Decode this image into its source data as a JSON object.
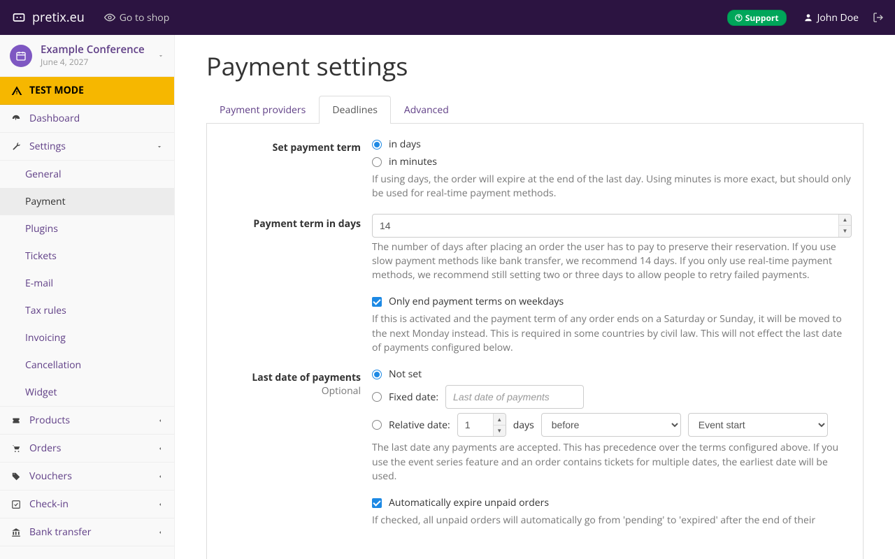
{
  "navbar": {
    "brand": "pretix.eu",
    "go_to_shop": "Go to shop",
    "support": "Support",
    "user": "John Doe"
  },
  "event": {
    "name": "Example Conference",
    "date": "June 4, 2027"
  },
  "test_mode": "TEST MODE",
  "sidebar": {
    "dashboard": "Dashboard",
    "settings": "Settings",
    "settings_sub": {
      "general": "General",
      "payment": "Payment",
      "plugins": "Plugins",
      "tickets": "Tickets",
      "email": "E-mail",
      "tax_rules": "Tax rules",
      "invoicing": "Invoicing",
      "cancellation": "Cancellation",
      "widget": "Widget"
    },
    "products": "Products",
    "orders": "Orders",
    "vouchers": "Vouchers",
    "checkin": "Check-in",
    "bank_transfer": "Bank transfer"
  },
  "page": {
    "title": "Payment settings",
    "tabs": {
      "providers": "Payment providers",
      "deadlines": "Deadlines",
      "advanced": "Advanced"
    }
  },
  "form": {
    "set_term": {
      "label": "Set payment term",
      "opt_days": "in days",
      "opt_minutes": "in minutes",
      "help": "If using days, the order will expire at the end of the last day. Using minutes is more exact, but should only be used for real-time payment methods."
    },
    "term_days": {
      "label": "Payment term in days",
      "value": "14",
      "help": "The number of days after placing an order the user has to pay to preserve their reservation. If you use slow payment methods like bank transfer, we recommend 14 days. If you only use real-time payment methods, we recommend still setting two or three days to allow people to retry failed payments."
    },
    "weekdays": {
      "label": "Only end payment terms on weekdays",
      "help": "If this is activated and the payment term of any order ends on a Saturday or Sunday, it will be moved to the next Monday instead. This is required in some countries by civil law. This will not effect the last date of payments configured below."
    },
    "last_date": {
      "label": "Last date of payments",
      "optional": "Optional",
      "not_set": "Not set",
      "fixed": "Fixed date:",
      "fixed_placeholder": "Last date of payments",
      "relative": "Relative date:",
      "rel_value": "1",
      "rel_days": "days",
      "rel_before": "before",
      "rel_anchor": "Event start",
      "help": "The last date any payments are accepted. This has precedence over the terms configured above. If you use the event series feature and an order contains tickets for multiple dates, the earliest date will be used."
    },
    "auto_expire": {
      "label": "Automatically expire unpaid orders",
      "help": "If checked, all unpaid orders will automatically go from 'pending' to 'expired' after the end of their"
    }
  }
}
